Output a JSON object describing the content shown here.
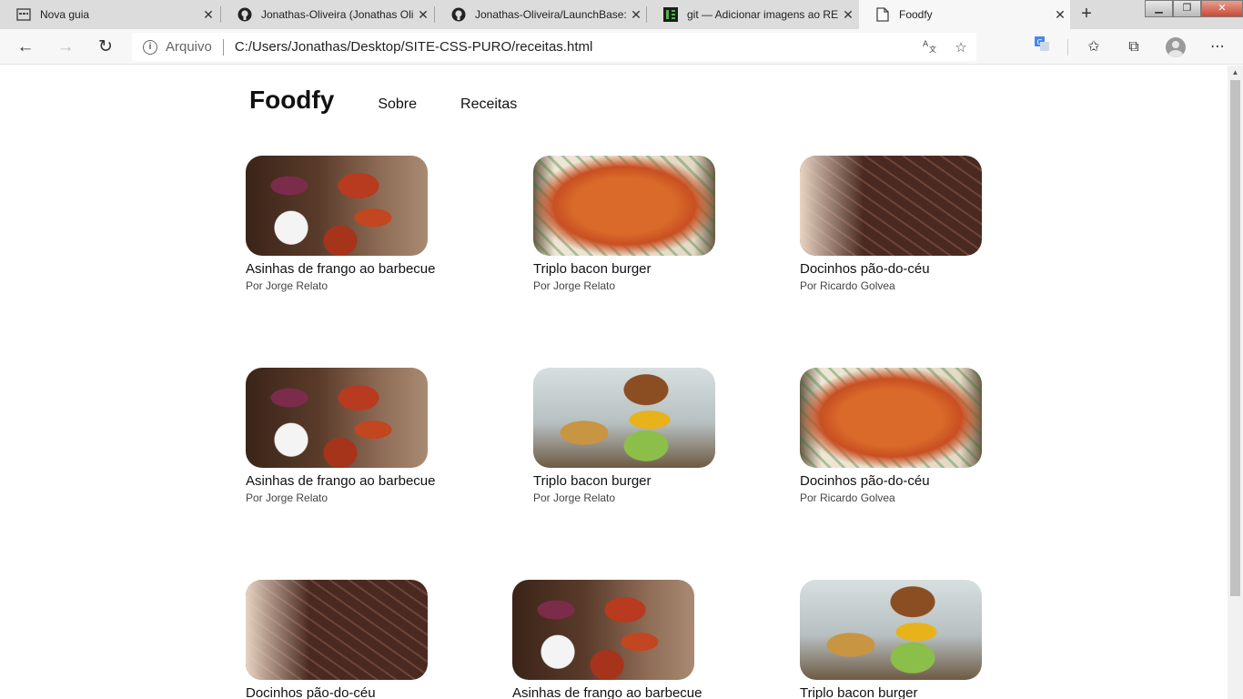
{
  "browser": {
    "tabs": [
      {
        "title": "Nova guia",
        "icon": "new-tab-page-icon",
        "active": false
      },
      {
        "title": "Jonathas-Oliveira (Jonathas Oliv",
        "icon": "github-icon",
        "active": false
      },
      {
        "title": "Jonathas-Oliveira/LaunchBase: I",
        "icon": "github-icon",
        "active": false
      },
      {
        "title": "git — Adicionar imagens ao REA",
        "icon": "stackoverflow-icon",
        "active": false
      },
      {
        "title": "Foodfy",
        "icon": "page-icon",
        "active": true
      }
    ],
    "address": {
      "scheme_label": "Arquivo",
      "url": "C:/Users/Jonathas/Desktop/SITE-CSS-PURO/receitas.html"
    }
  },
  "site": {
    "logo": "Foodfy",
    "nav": [
      "Sobre",
      "Receitas"
    ]
  },
  "recipes": [
    {
      "title": "Asinhas de frango ao barbecue",
      "author": "Por Jorge Relato",
      "image": "wings"
    },
    {
      "title": "Triplo bacon burger",
      "author": "Por Jorge Relato",
      "image": "mac"
    },
    {
      "title": "Docinhos pão-do-céu",
      "author": "Por Ricardo Golvea",
      "image": "choc"
    },
    {
      "title": "Asinhas de frango ao barbecue",
      "author": "Por Jorge Relato",
      "image": "wings"
    },
    {
      "title": "Triplo bacon burger",
      "author": "Por Jorge Relato",
      "image": "burger"
    },
    {
      "title": "Docinhos pão-do-céu",
      "author": "Por Ricardo Golvea",
      "image": "mac"
    },
    {
      "title": "Docinhos pão-do-céu",
      "author": "",
      "image": "choc"
    },
    {
      "title": "Asinhas de frango ao barbecue",
      "author": "",
      "image": "wings"
    },
    {
      "title": "Triplo bacon burger",
      "author": "",
      "image": "burger"
    }
  ]
}
